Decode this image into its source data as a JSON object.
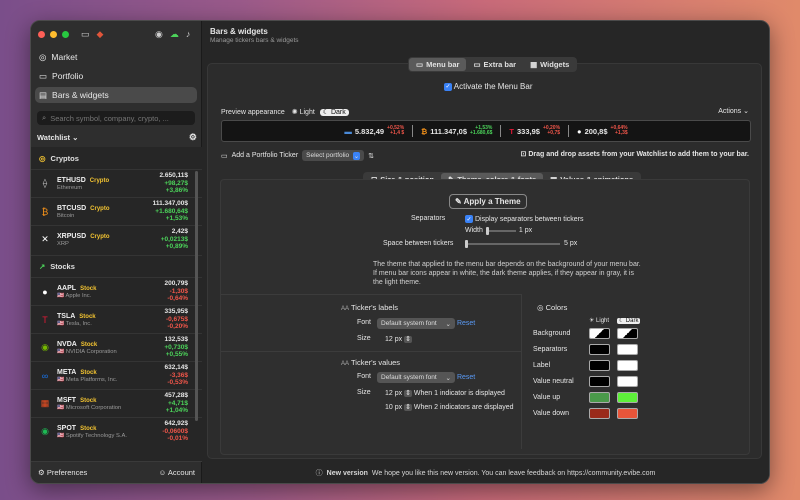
{
  "sidebar": {
    "nav": [
      {
        "label": "Market",
        "icon": "market-icon"
      },
      {
        "label": "Portfolio",
        "icon": "portfolio-icon"
      },
      {
        "label": "Bars & widgets",
        "icon": "bars-widgets-icon"
      }
    ],
    "search_placeholder": "Search symbol, company, crypto, ...",
    "watchlist_label": "Watchlist",
    "sections": [
      {
        "title": "Cryptos",
        "items": [
          {
            "symbol": "ETHUSD",
            "tag": "Crypto",
            "name": "Ethereum",
            "price": "2.650,11$",
            "change": "+98,27$",
            "pct": "+3,86%",
            "up": true,
            "icon": "ethereum-icon",
            "color": "#c0c0c0"
          },
          {
            "symbol": "BTCUSD",
            "tag": "Crypto",
            "name": "Bitcoin",
            "price": "111.347,00$",
            "change": "+1.680,64$",
            "pct": "+1,53%",
            "up": true,
            "icon": "bitcoin-icon",
            "color": "#f7931a"
          },
          {
            "symbol": "XRPUSD",
            "tag": "Crypto",
            "name": "XRP",
            "price": "2,42$",
            "change": "+0,0213$",
            "pct": "+0,89%",
            "up": true,
            "icon": "xrp-icon",
            "color": "#ffffff"
          }
        ]
      },
      {
        "title": "Stocks",
        "items": [
          {
            "symbol": "AAPL",
            "tag": "Stock",
            "name": "🇺🇸 Apple Inc.",
            "price": "200,79$",
            "change": "-1,30$",
            "pct": "-0,64%",
            "up": false,
            "icon": "apple-icon",
            "color": "#ffffff"
          },
          {
            "symbol": "TSLA",
            "tag": "Stock",
            "name": "🇺🇸 Tesla, Inc.",
            "price": "335,95$",
            "change": "-0,675$",
            "pct": "-0,20%",
            "up": false,
            "icon": "tesla-icon",
            "color": "#e31937"
          },
          {
            "symbol": "NVDA",
            "tag": "Stock",
            "name": "🇺🇸 NVIDIA Corporation",
            "price": "132,53$",
            "change": "+0,730$",
            "pct": "+0,55%",
            "up": true,
            "icon": "nvidia-icon",
            "color": "#76b900"
          },
          {
            "symbol": "META",
            "tag": "Stock",
            "name": "🇺🇸 Meta Platforms, Inc.",
            "price": "632,14$",
            "change": "-3,36$",
            "pct": "-0,53%",
            "up": false,
            "icon": "meta-icon",
            "color": "#1877f2"
          },
          {
            "symbol": "MSFT",
            "tag": "Stock",
            "name": "🇺🇸 Microsoft Corporation",
            "price": "457,28$",
            "change": "+4,71$",
            "pct": "+1,04%",
            "up": true,
            "icon": "microsoft-icon",
            "color": "#f25022"
          },
          {
            "symbol": "SPOT",
            "tag": "Stock",
            "name": "🇺🇸 Spotify Technology S.A.",
            "price": "642,92$",
            "change": "-0,0600$",
            "pct": "-0,01%",
            "up": false,
            "icon": "spotify-icon",
            "color": "#1db954"
          }
        ]
      }
    ],
    "preferences": "Preferences",
    "account": "Account"
  },
  "header": {
    "title": "Bars & widgets",
    "subtitle": "Manage tickers bars & widgets"
  },
  "tabs": [
    "Menu bar",
    "Extra bar",
    "Widgets"
  ],
  "activate": "Activate the Menu Bar",
  "preview_label": "Preview appearance",
  "light": "Light",
  "dark": "Dark",
  "actions": "Actions",
  "preview": [
    {
      "price": "5.832,49",
      "c1": "+0,52%",
      "c2": "+1,4 $",
      "icon": "index-icon"
    },
    {
      "price": "111.347,0$",
      "c1": "+1,53%",
      "c2": "+1.680,6$",
      "icon": "bitcoin-icon"
    },
    {
      "price": "333,9$",
      "c1": "+0,20%",
      "c2": "+0,7$",
      "icon": "tesla-icon"
    },
    {
      "price": "200,8$",
      "c1": "+0,64%",
      "c2": "+1,3$",
      "icon": "apple-icon"
    }
  ],
  "add_portfolio": "Add a Portfolio Ticker",
  "select_portfolio": "Select portfolio",
  "drag_hint": "Drag and drop assets from your Watchlist to add them to your bar.",
  "subtabs": [
    "Size & position",
    "Theme, colors & fonts",
    "Values & animations"
  ],
  "apply_theme": "Apply a Theme",
  "separators_label": "Separators",
  "separators_chk": "Display separators between tickers",
  "width_label": "Width",
  "width_val": "1 px",
  "space_label": "Space between tickers",
  "space_val": "5 px",
  "theme_note": "The theme that applied to the menu bar depends on the background of your menu bar. If menu bar icons appear in white, the dark theme applies, if they appear in gray, it is the light theme.",
  "tickers_labels": "Ticker's labels",
  "tickers_values": "Ticker's values",
  "font_label": "Font",
  "size_label": "Size",
  "default_font": "Default system font",
  "reset": "Reset",
  "label_size": "12 px",
  "val_size1": "12 px",
  "val_size2": "10 px",
  "one_ind": "When 1 indicator is displayed",
  "two_ind": "When 2 indicators are displayed",
  "colors_title": "Colors",
  "color_rows": [
    {
      "label": "Background",
      "light": "#ffffff",
      "dark": "#000000"
    },
    {
      "label": "Separators",
      "light": "#000000",
      "dark": "#ffffff"
    },
    {
      "label": "Label",
      "light": "#000000",
      "dark": "#ffffff"
    },
    {
      "label": "Value neutral",
      "light": "#000000",
      "dark": "#ffffff"
    },
    {
      "label": "Value up",
      "light": "#4a9a4a",
      "dark": "#5ef03a"
    },
    {
      "label": "Value down",
      "light": "#9a2a1a",
      "dark": "#e8553a"
    }
  ],
  "footer": {
    "badge": "New version",
    "text": "We hope you like this new version. You can leave feedback on https://community.evibe.com"
  },
  "accent": "#3a82f6",
  "up_color": "#4cd35a",
  "down_color": "#f0564a"
}
